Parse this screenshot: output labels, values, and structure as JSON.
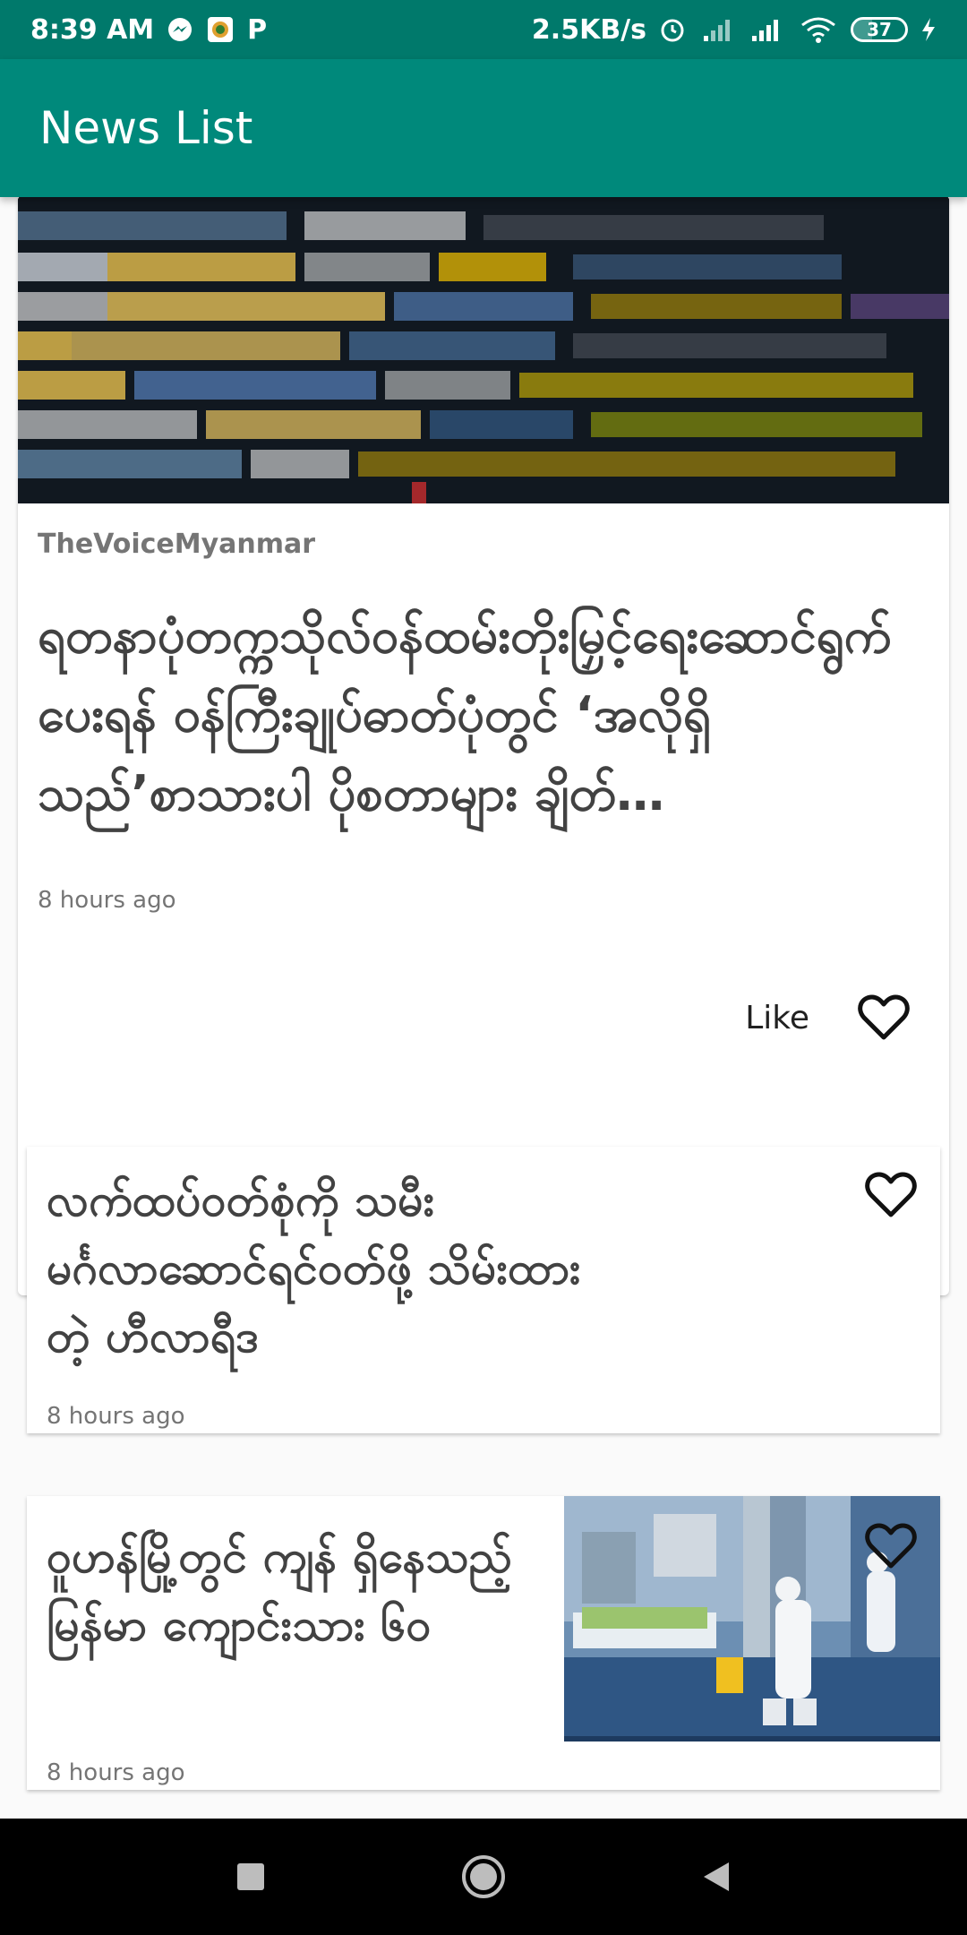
{
  "status_bar": {
    "time": "8:39 AM",
    "speed": "2.5KB/s",
    "battery": "37",
    "battery_level_percent": 37,
    "icons": [
      "messenger-icon",
      "app-icon",
      "p-icon",
      "alarm-icon",
      "signal-icon",
      "signal-icon",
      "wifi-icon",
      "battery-icon",
      "charging-icon"
    ]
  },
  "app_bar": {
    "title": "News List"
  },
  "featured": {
    "source": "TheVoiceMyanmar",
    "headline": "ရတနာပုံတက္ကသိုလ်ဝန်ထမ်းတိုးမြှင့်ရေးဆောင်ရွက်ပေးရန် ဝန်ကြီးချုပ်ဓာတ်ပုံတွင် ‘အလိုရှိသည်’စာသားပါ ပိုစတာများ ချိတ်…",
    "time": "8 hours ago",
    "like_label": "Like",
    "liked": false
  },
  "news_items": [
    {
      "title": "လက်ထပ်ဝတ်စုံကို သမီး မင်္ဂလာဆောင်ရင်ဝတ်ဖို့ သိမ်းထားတဲ့ ဟီလာရီဒ",
      "time": "8 hours ago",
      "liked": false,
      "has_image": false
    },
    {
      "title": "ဝူဟန်မြို့တွင် ကျန် ရှိနေသည့် မြန်မာ ကျောင်းသား ၆၀",
      "time": "8 hours ago",
      "liked": false,
      "has_image": true
    }
  ],
  "colors": {
    "status_bar": "#00796b",
    "app_bar": "#00897b",
    "background": "#fafafa",
    "card": "#ffffff",
    "headline_text": "#424242",
    "meta_text": "#757575"
  },
  "nav_bar": {
    "icons": [
      "recents-square-icon",
      "home-circle-icon",
      "back-triangle-icon"
    ]
  }
}
